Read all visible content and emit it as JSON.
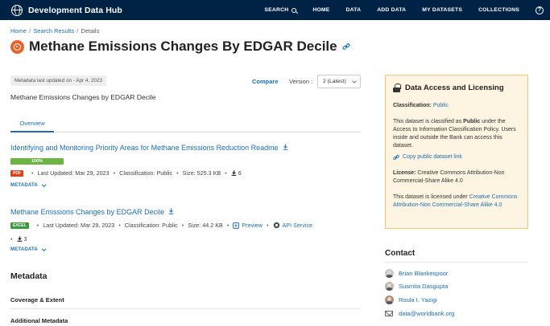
{
  "nav": {
    "brand": "Development Data Hub",
    "links": [
      "SEARCH",
      "HOME",
      "DATA",
      "ADD DATA",
      "MY DATASETS",
      "COLLECTIONS"
    ],
    "help": "?"
  },
  "breadcrumb": [
    "Home",
    "Search Results",
    "Details"
  ],
  "title": "Methane Emissions Changes By EDGAR Decile",
  "meta": {
    "updated": "Metadata last updated on - Apr 4, 2023",
    "compare": "Compare",
    "version_label": "Version :",
    "version_value": "2 (Latest)",
    "description": "Methane Emissions Changes by EDGAR Decile"
  },
  "tabs": [
    "Overview"
  ],
  "resources": [
    {
      "title": "Identifying and Monitoring Priority Areas for Methane Emissions Reduction Readme",
      "progress_label": "100%",
      "progress": 100,
      "format": "PDF",
      "last_updated": "Last Updated: Mar 29, 2023",
      "classification": "Classification: Public",
      "size": "Size: 525.3 KB",
      "downloads": "6",
      "metadata_label": "METADATA"
    },
    {
      "title": "Methane Emissions Changes by EDGAR Decile",
      "format": "EXCEL",
      "last_updated": "Last Updated: Mar 29, 2023",
      "classification": "Classification: Public",
      "size": "Size: 44.2 KB",
      "preview": "Preview",
      "api": "API Service",
      "downloads": "3",
      "metadata_label": "METADATA"
    }
  ],
  "metadata_section": {
    "heading": "Metadata",
    "items": [
      "Coverage & Extent",
      "Additional Metadata"
    ]
  },
  "access": {
    "title": "Data Access and Licensing",
    "classification_label": "Classification:",
    "classification_value": "Public",
    "para1_a": "This dataset is classified as ",
    "para1_b": "Public",
    "para1_c": " under the Access to Information Classification Policy. Users inside and outside the Bank can access this dataset.",
    "copy_link": "Copy public dataset link",
    "license_label": "License:",
    "license_value": " Creative Commons Attribution-Non Commercial-Share Alike 4.0",
    "para2_a": "This dataset is licensed under ",
    "para2_link": "Creative Commons Attribution-Non Commercial-Share Alike 4.0"
  },
  "contact": {
    "title": "Contact",
    "people": [
      "Brian Blankespoor",
      "Susmita Dasgupta",
      "Roula I. Yazigi"
    ],
    "email": "data@worldbank.org"
  },
  "colors": {
    "nav_bg": "#002244",
    "link": "#1a6fb5",
    "progress": "#6db542",
    "pdf": "#d9441c",
    "excel": "#3c9a3c",
    "access_bg": "#fdf5e1",
    "access_border": "#f0c674",
    "dataset_icon": "#e8632b"
  }
}
